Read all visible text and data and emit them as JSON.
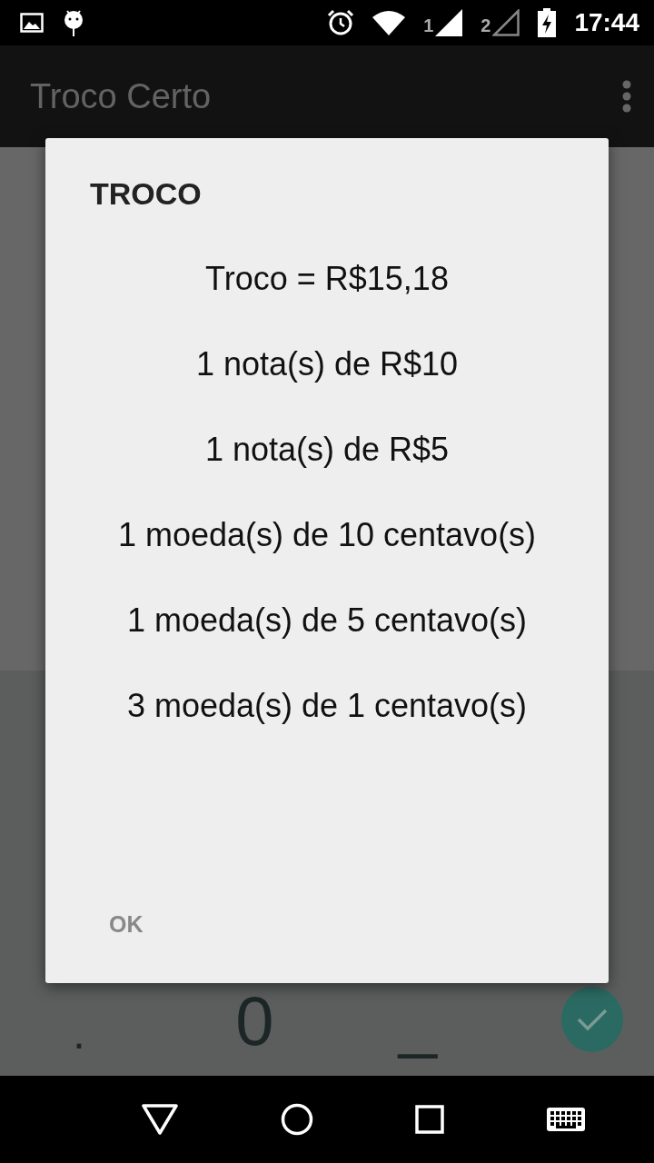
{
  "status_bar": {
    "sim_1": "1",
    "sim_2": "2",
    "time": "17:44"
  },
  "app_bar": {
    "title": "Troco Certo"
  },
  "keypad": {
    "keys": [
      ".",
      "0",
      "_"
    ]
  },
  "dialog": {
    "title": "TROCO",
    "lines": [
      "Troco = R$15,18",
      "1 nota(s) de R$10",
      "1 nota(s) de R$5",
      "1 moeda(s) de 10 centavo(s)",
      "1 moeda(s) de 5 centavo(s)",
      "3 moeda(s) de 1 centavo(s)"
    ],
    "button": "OK"
  }
}
